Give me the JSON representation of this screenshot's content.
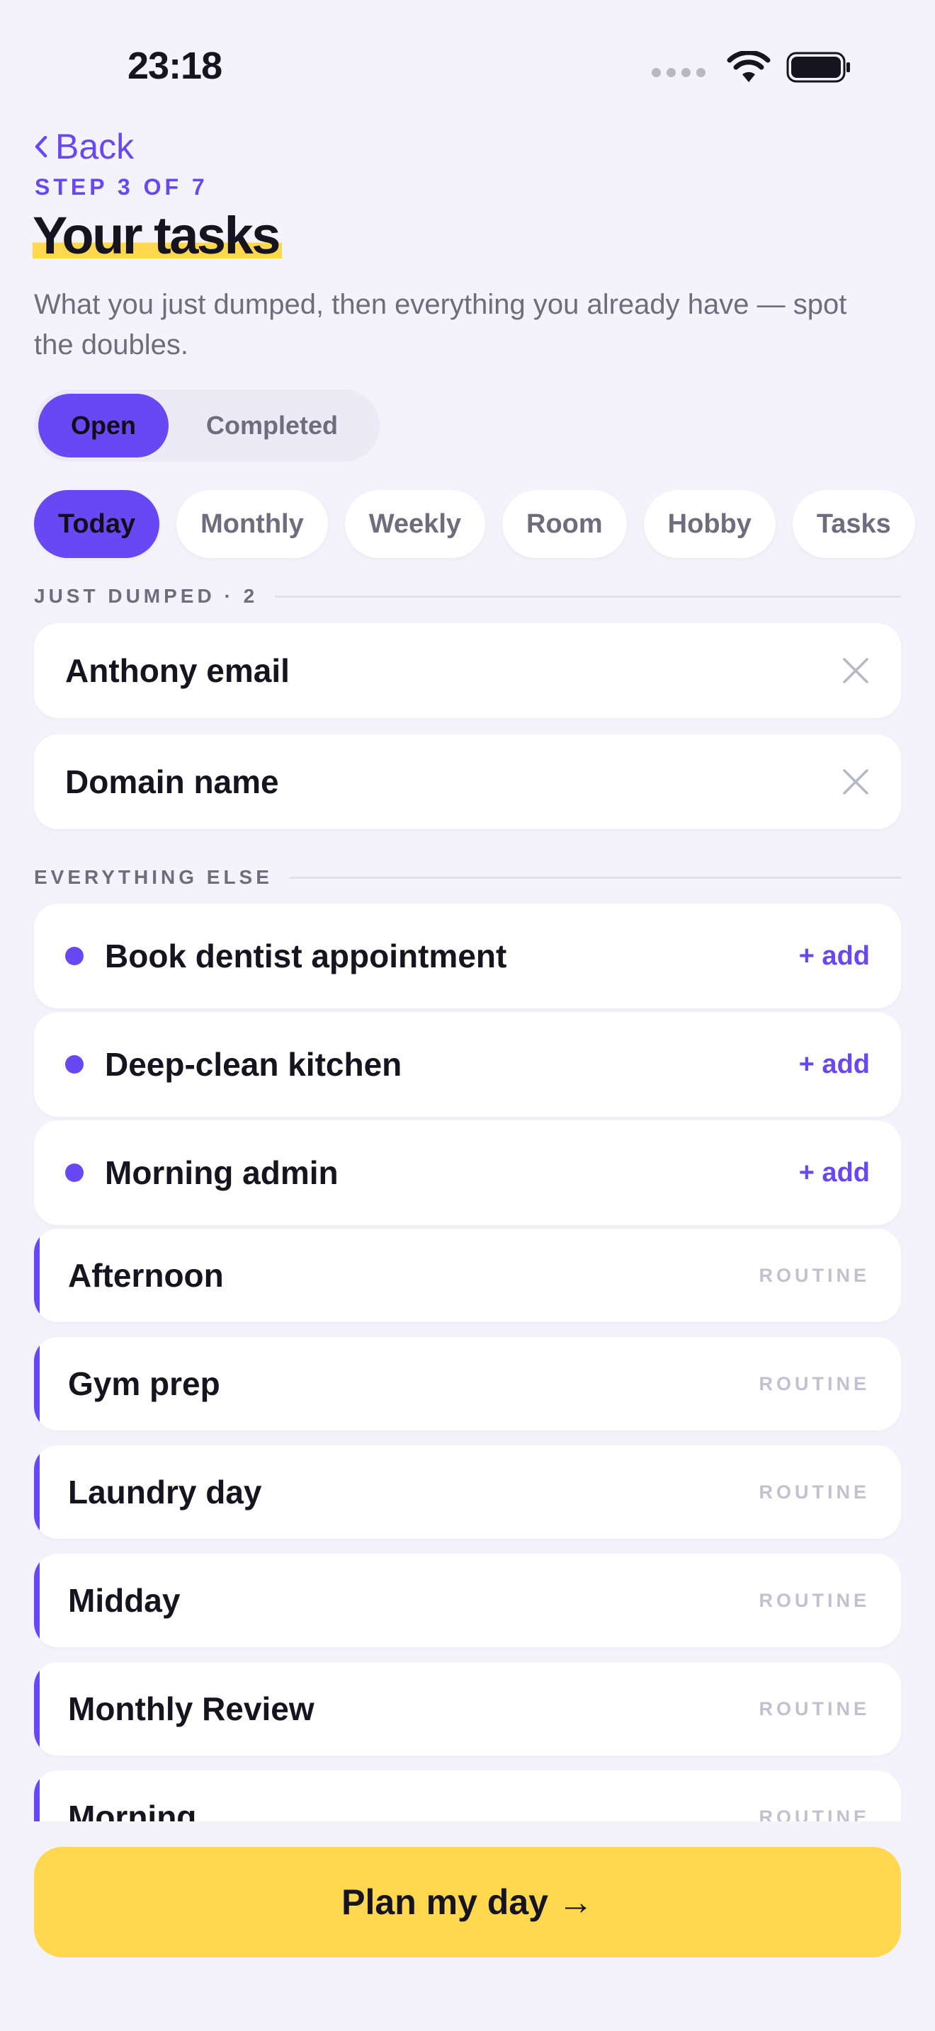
{
  "status_bar": {
    "time": "23:18"
  },
  "header": {
    "back_label": "Back",
    "step": "STEP 3 OF 7",
    "title": "Your tasks",
    "subtitle": "What you just dumped, then everything you already have — spot the doubles."
  },
  "toggle": {
    "open_label": "Open",
    "completed_label": "Completed",
    "selected": "Open"
  },
  "filters": {
    "selected": "Today",
    "items": [
      "Today",
      "Monthly",
      "Weekly",
      "Room",
      "Hobby",
      "Tasks"
    ]
  },
  "just_dumped": {
    "heading": "JUST DUMPED · 2",
    "items": [
      "Anthony email",
      "Domain name"
    ]
  },
  "everything_else": {
    "heading": "EVERYTHING ELSE",
    "add_label": "+ add",
    "tasks": [
      "Book dentist appointment",
      "Deep-clean kitchen",
      "Morning admin"
    ],
    "routine_tag": "ROUTINE",
    "routines": [
      "Afternoon",
      "Gym prep",
      "Laundry day",
      "Midday",
      "Monthly Review",
      "Morning"
    ]
  },
  "footer": {
    "primary_label": "Plan my day →"
  },
  "colors": {
    "accent": "#6748f2",
    "highlight": "#ffd84f",
    "background": "#f4f3fb"
  },
  "icons": [
    "back-chevron-icon",
    "wifi-icon",
    "battery-icon",
    "close-icon"
  ]
}
